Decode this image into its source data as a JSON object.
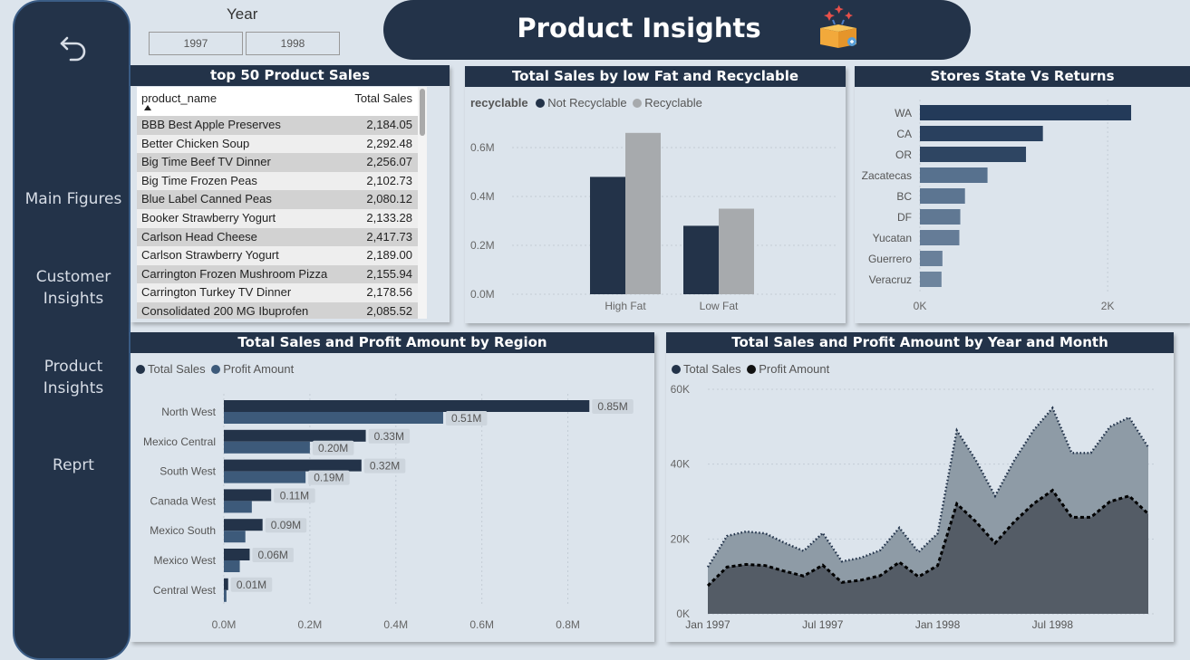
{
  "nav": {
    "items": [
      "Main Figures",
      "Customer Insights",
      "Product Insights",
      "Reprt"
    ]
  },
  "slicer": {
    "title": "Year",
    "options": [
      "1997",
      "1998"
    ]
  },
  "banner": {
    "title": "Product Insights"
  },
  "colors": {
    "navy": "#233349",
    "steel": "#3d5a7a",
    "gray": "#a7aaad",
    "area_sales": "#8e9ba6",
    "area_profit": "#545c66"
  },
  "products_table": {
    "title": "top 50 Product Sales",
    "columns": [
      "product_name",
      "Total Sales"
    ],
    "rows": [
      [
        "BBB Best Apple Preserves",
        "2,184.05"
      ],
      [
        "Better Chicken Soup",
        "2,292.48"
      ],
      [
        "Big Time Beef TV Dinner",
        "2,256.07"
      ],
      [
        "Big Time Frozen Peas",
        "2,102.73"
      ],
      [
        "Blue Label Canned Peas",
        "2,080.12"
      ],
      [
        "Booker Strawberry Yogurt",
        "2,133.28"
      ],
      [
        "Carlson Head Cheese",
        "2,417.73"
      ],
      [
        "Carlson Strawberry Yogurt",
        "2,189.00"
      ],
      [
        "Carrington Frozen Mushroom Pizza",
        "2,155.94"
      ],
      [
        "Carrington Turkey TV Dinner",
        "2,178.56"
      ],
      [
        "Consolidated 200 MG Ibuprofen",
        "2,085.52"
      ]
    ]
  },
  "chart_data": [
    {
      "type": "bar",
      "title": "Total Sales by low Fat and Recyclable",
      "legend_title": "recyclable",
      "legend_position": "top-left",
      "categories": [
        "High Fat",
        "Low Fat"
      ],
      "series": [
        {
          "name": "Not Recyclable",
          "values": [
            0.48,
            0.28
          ]
        },
        {
          "name": "Recyclable",
          "values": [
            0.66,
            0.35
          ]
        }
      ],
      "yticks": [
        "0.0M",
        "0.2M",
        "0.4M",
        "0.6M"
      ],
      "ylim": [
        0,
        0.7
      ],
      "grid": true
    },
    {
      "type": "bar",
      "orientation": "horizontal",
      "title": "Stores State Vs Returns",
      "categories": [
        "WA",
        "CA",
        "OR",
        "Zacatecas",
        "BC",
        "DF",
        "Yucatan",
        "Guerrero",
        "Veracruz"
      ],
      "values": [
        2250,
        1310,
        1130,
        720,
        480,
        430,
        420,
        240,
        230
      ],
      "xticks": [
        "0K",
        "2K"
      ],
      "xlim": [
        0,
        2800
      ],
      "grid": true
    },
    {
      "type": "bar",
      "orientation": "horizontal",
      "title": "Total Sales and Profit Amount by Region",
      "legend_position": "top-left",
      "categories": [
        "North West",
        "Mexico Central",
        "South West",
        "Canada West",
        "Mexico South",
        "Mexico West",
        "Central West"
      ],
      "series": [
        {
          "name": "Total Sales",
          "values": [
            0.85,
            0.33,
            0.32,
            0.11,
            0.09,
            0.06,
            0.01
          ],
          "labels": [
            "0.85M",
            "0.33M",
            "0.32M",
            "0.11M",
            "0.09M",
            "0.06M",
            "0.01M"
          ]
        },
        {
          "name": "Profit Amount",
          "values": [
            0.51,
            0.2,
            0.19,
            0.065,
            0.05,
            0.037,
            0.006
          ],
          "labels": [
            "0.51M",
            "0.20M",
            "0.19M",
            "",
            "",
            "",
            ""
          ]
        }
      ],
      "xticks": [
        "0.0M",
        "0.2M",
        "0.4M",
        "0.6M",
        "0.8M"
      ],
      "xlim": [
        0,
        0.9
      ],
      "grid": true
    },
    {
      "type": "area",
      "title": "Total Sales and Profit Amount by Year and Month",
      "legend_position": "top-left",
      "x": [
        "Jan 1997",
        "Feb 1997",
        "Mar 1997",
        "Apr 1997",
        "May 1997",
        "Jun 1997",
        "Jul 1997",
        "Aug 1997",
        "Sep 1997",
        "Oct 1997",
        "Nov 1997",
        "Dec 1997",
        "Jan 1998",
        "Feb 1998",
        "Mar 1998",
        "Apr 1998",
        "May 1998",
        "Jun 1998",
        "Jul 1998",
        "Aug 1998",
        "Sep 1998",
        "Oct 1998",
        "Nov 1998",
        "Dec 1998"
      ],
      "series": [
        {
          "name": "Total Sales",
          "values": [
            12500,
            20800,
            22000,
            21500,
            19000,
            16800,
            21600,
            14000,
            15000,
            17000,
            23000,
            16500,
            21500,
            49000,
            41000,
            31500,
            41000,
            49000,
            55000,
            43000,
            43000,
            50000,
            52500,
            44500
          ]
        },
        {
          "name": "Profit Amount",
          "values": [
            7500,
            12500,
            13200,
            12900,
            11400,
            10100,
            13000,
            8400,
            9000,
            10200,
            13800,
            9900,
            12900,
            29400,
            24600,
            18900,
            24600,
            29400,
            33000,
            25800,
            25800,
            30000,
            31500,
            26700
          ]
        }
      ],
      "xticks": [
        "Jan 1997",
        "Jul 1997",
        "Jan 1998",
        "Jul 1998"
      ],
      "yticks": [
        "0K",
        "20K",
        "40K",
        "60K"
      ],
      "ylim": [
        0,
        60000
      ],
      "grid": true
    }
  ]
}
